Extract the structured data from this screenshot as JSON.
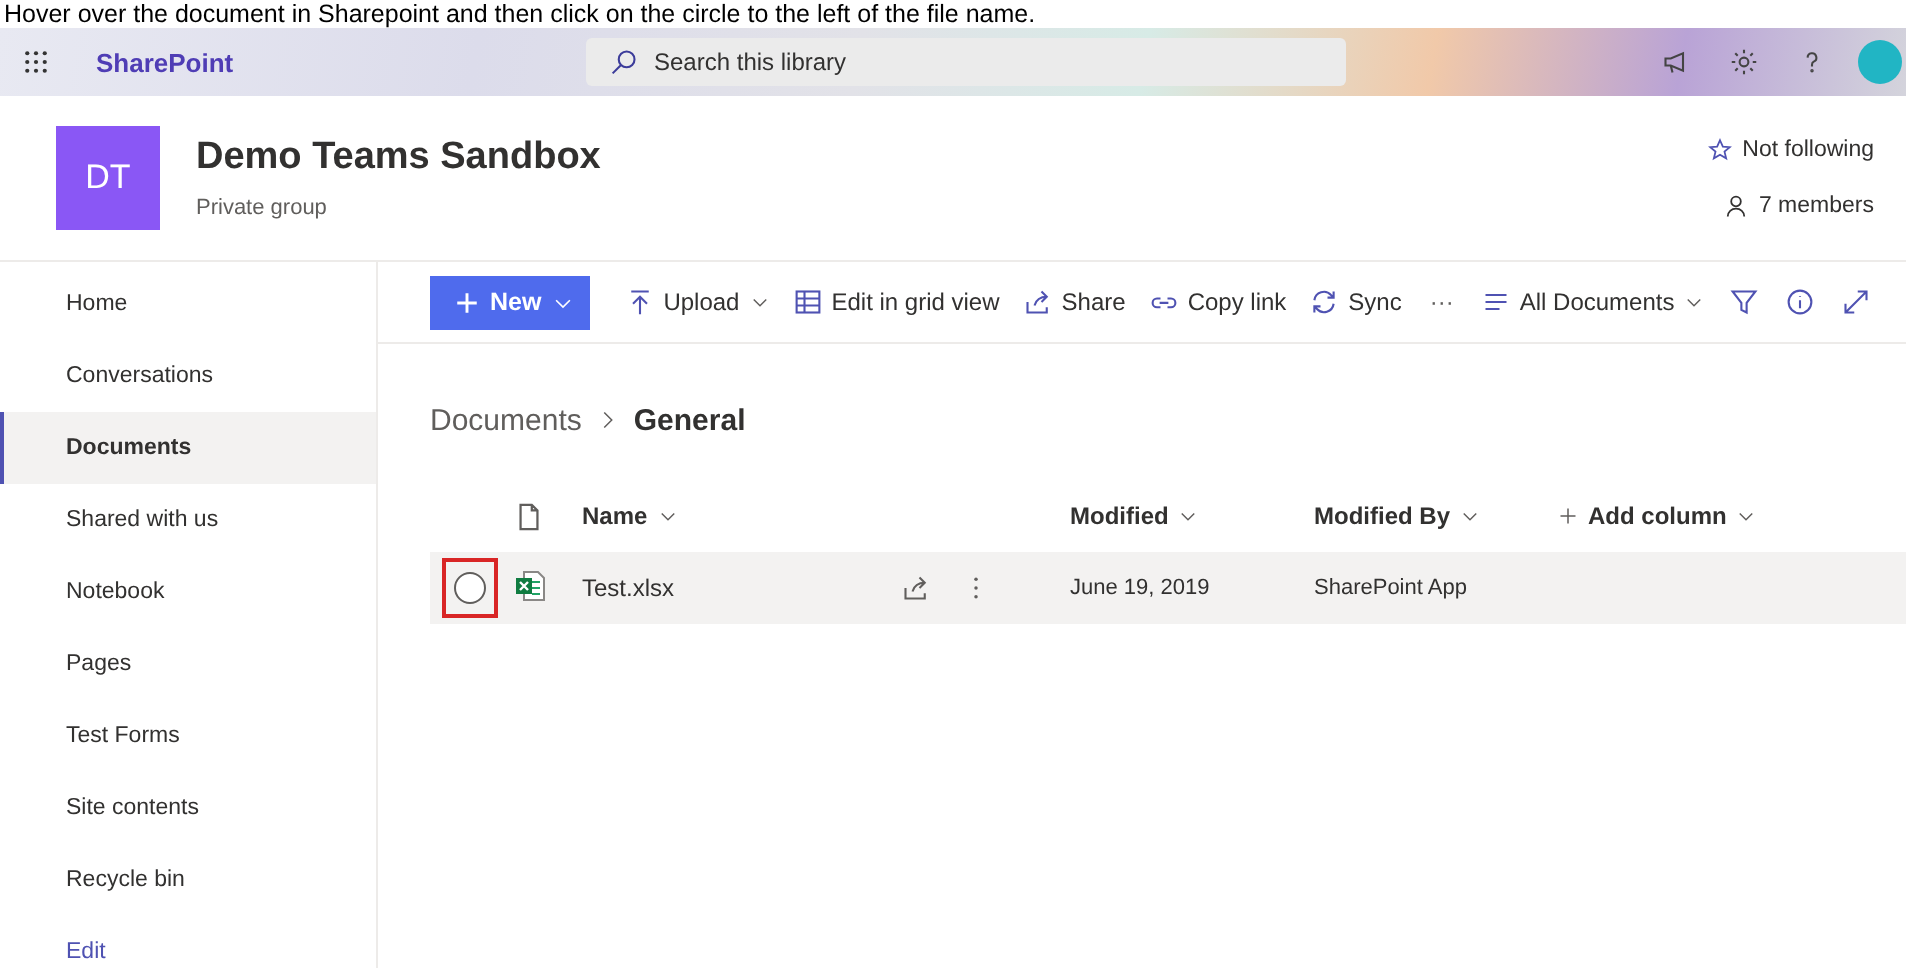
{
  "caption": "Hover over the document in Sharepoint and then click on the circle to the left of the file name.",
  "suite_bar": {
    "app_name": "SharePoint",
    "search": {
      "placeholder": "Search this library"
    }
  },
  "site_header": {
    "logo_initials": "DT",
    "title": "Demo Teams Sandbox",
    "subtitle": "Private group",
    "follow": "Not following",
    "members": "7 members"
  },
  "nav": {
    "items": [
      {
        "label": "Home",
        "selected": false
      },
      {
        "label": "Conversations",
        "selected": false
      },
      {
        "label": "Documents",
        "selected": true
      },
      {
        "label": "Shared with us",
        "selected": false
      },
      {
        "label": "Notebook",
        "selected": false
      },
      {
        "label": "Pages",
        "selected": false
      },
      {
        "label": "Test Forms",
        "selected": false
      },
      {
        "label": "Site contents",
        "selected": false
      },
      {
        "label": "Recycle bin",
        "selected": false
      }
    ],
    "edit_link": "Edit"
  },
  "command_bar": {
    "new_button": "New",
    "commands": [
      {
        "kind": "upload",
        "label": "Upload"
      },
      {
        "kind": "grid",
        "label": "Edit in grid view"
      },
      {
        "kind": "share",
        "label": "Share"
      },
      {
        "kind": "link",
        "label": "Copy link"
      },
      {
        "kind": "sync",
        "label": "Sync"
      }
    ],
    "more": "···",
    "view": "All Documents"
  },
  "breadcrumb": [
    {
      "label": "Documents",
      "current": false
    },
    {
      "label": "General",
      "current": true
    }
  ],
  "table": {
    "columns": [
      "Name",
      "Modified",
      "Modified By",
      "Add column"
    ],
    "rows": [
      {
        "name": "Test.xlsx",
        "modified": "June 19, 2019",
        "modified_by": "SharePoint App",
        "hovered": true,
        "selected": false,
        "highlighted": true
      }
    ]
  }
}
